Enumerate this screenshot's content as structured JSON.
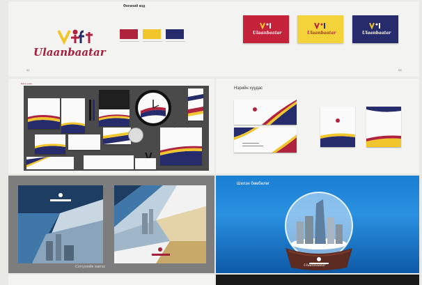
{
  "top": {
    "color_heading": "Өнгөний код",
    "logo_text": "Ulaanbaatar",
    "swatches": [
      {
        "name": "red",
        "hex": "#b0233f"
      },
      {
        "name": "yellow",
        "hex": "#f1c52c"
      },
      {
        "name": "navy",
        "hex": "#262b6b"
      }
    ],
    "brand_cards": [
      {
        "bg": "#c5233b",
        "text": "Ulaanbaatar"
      },
      {
        "bg": "#f4d23a",
        "text": "Ulaanbaatar"
      },
      {
        "bg": "#262b6b",
        "text": "Ulaanbaatar"
      }
    ],
    "page_left": "02",
    "page_right": "03"
  },
  "middle": {
    "left_subtitle": "Бичиг хэрэг",
    "right_title": "Нэрийн хуудас"
  },
  "bottom": {
    "left_caption": "Сэтгүүлийн хавтас",
    "right_label": "Шилэн бөмбөлөг",
    "globe_text": "Ulaanbaatar"
  }
}
